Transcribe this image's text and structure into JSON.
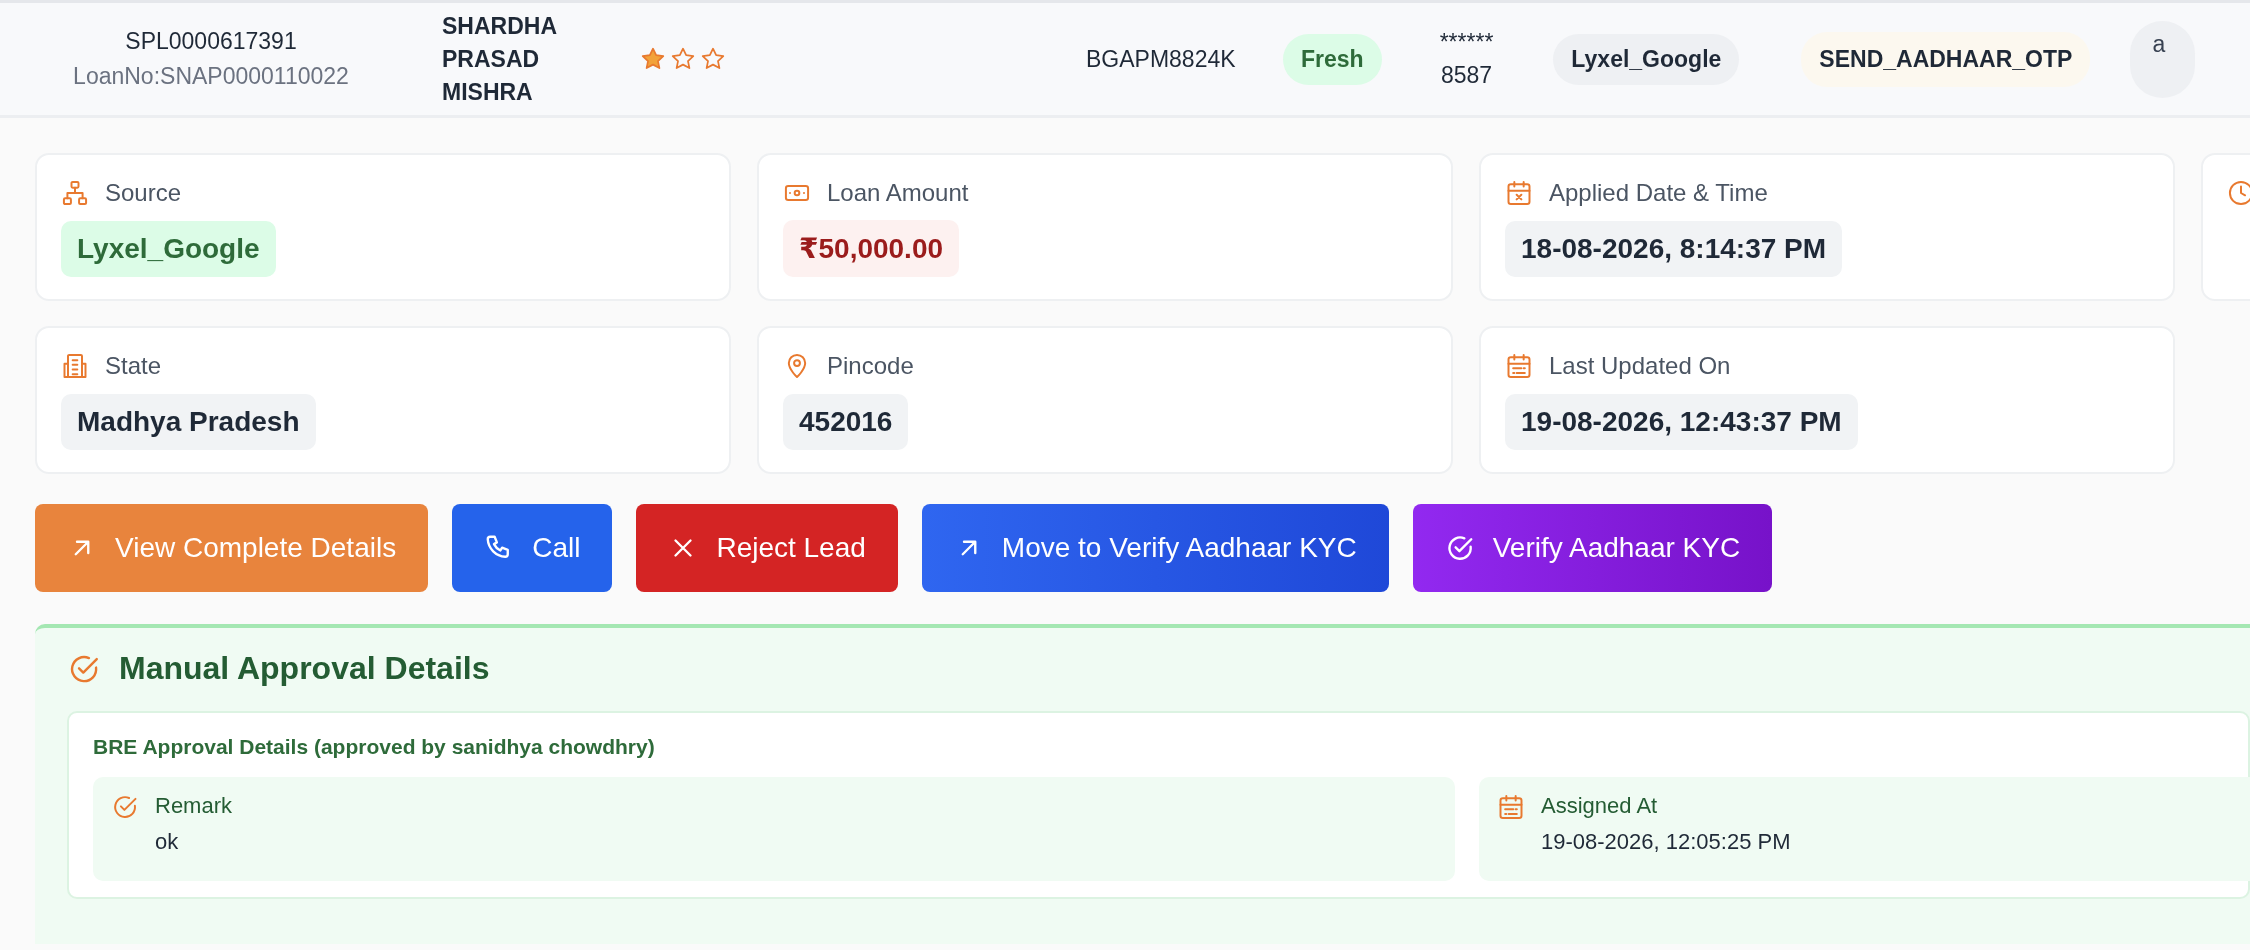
{
  "header": {
    "lead_id": "SPL0000617391",
    "loan_no": "LoanNo:SNAP0000110022",
    "name": "SHARDHA PRASAD MISHRA",
    "stars": 1,
    "pan": "BGAPM8824K",
    "status": "Fresh",
    "phone_mask": "******",
    "phone_last": "8587",
    "source_tag": "Lyxel_Google",
    "stage": "SEND_AADHAAR_OTP",
    "user_chip": "a"
  },
  "info_cards": [
    {
      "label": "Source",
      "value": "Lyxel_Google"
    },
    {
      "label": "Loan Amount",
      "value": "₹50,000.00"
    },
    {
      "label": "Applied Date & Time",
      "value": "18-08-2026, 8:14:37 PM"
    },
    {
      "label": "State",
      "value": "Madhya Pradesh"
    },
    {
      "label": "Pincode",
      "value": "452016"
    },
    {
      "label": "Last Updated On",
      "value": "19-08-2026, 12:43:37 PM"
    }
  ],
  "actions": [
    {
      "label": "View Complete Details"
    },
    {
      "label": "Call"
    },
    {
      "label": "Reject Lead"
    },
    {
      "label": "Move to Verify Aadhaar KYC"
    },
    {
      "label": "Verify Aadhaar KYC"
    }
  ],
  "approval": {
    "title": "Manual Approval Details",
    "block_title": "BRE Approval Details (approved by sanidhya chowdhry)",
    "items": [
      {
        "label": "Remark",
        "value": "ok"
      },
      {
        "label": "Assigned At",
        "value": "19-08-2026, 12:05:25 PM"
      }
    ]
  }
}
